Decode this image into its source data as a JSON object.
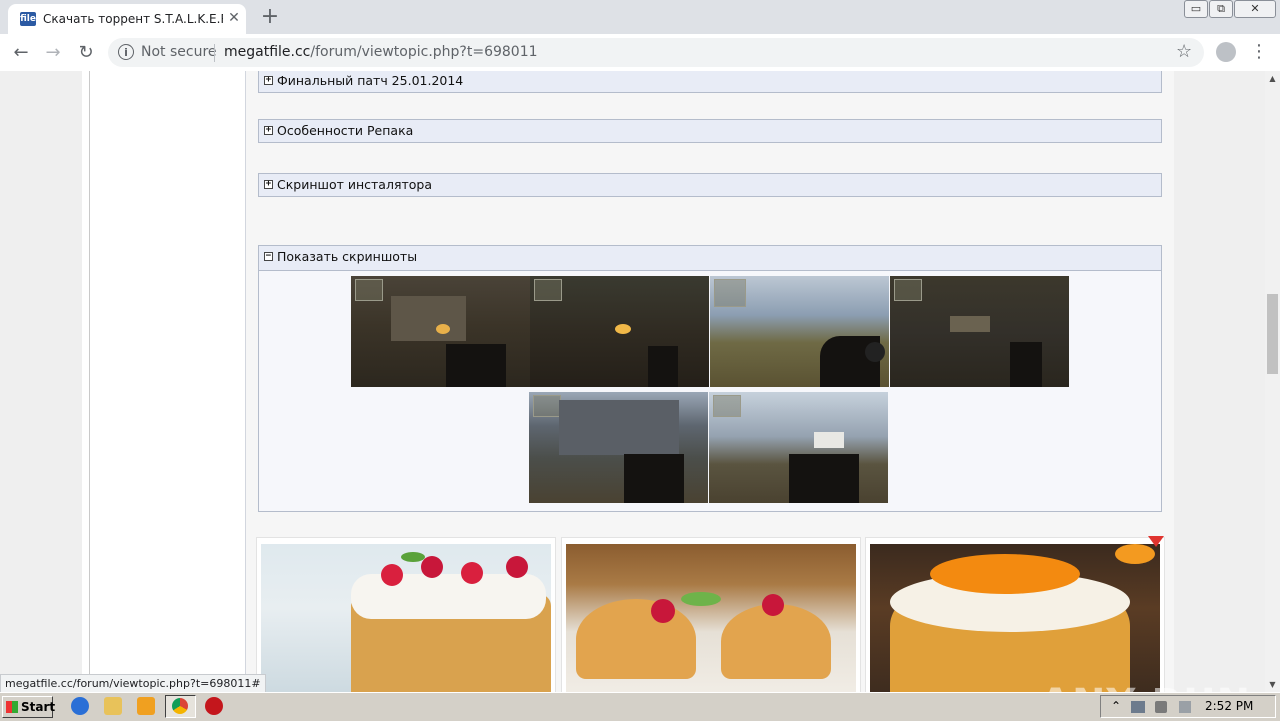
{
  "browser": {
    "tab": {
      "favicon_text": "file",
      "title": "Скачать торрент S.T.A.L.K.E.R.: S",
      "close_glyph": "✕"
    },
    "new_tab_glyph": "+",
    "window_controls": [
      "▭",
      "⧉",
      "✕"
    ],
    "nav": {
      "back": "←",
      "forward": "→",
      "reload": "↻"
    },
    "omnibox": {
      "security_label": "Not secure",
      "url_host": "megatfile.cc",
      "url_path": "/forum/viewtopic.php?t=698011"
    },
    "star_glyph": "☆",
    "menu_glyph": "⋮"
  },
  "post": {
    "spoilers": [
      {
        "label": "Финальный патч 25.01.2014",
        "icon": "+"
      },
      {
        "label": "Особенности Репака",
        "icon": "+"
      },
      {
        "label": "Скриншот инсталятора",
        "icon": "+"
      }
    ],
    "screenshots_spoiler": {
      "label": "Показать скриншоты",
      "icon": "−"
    }
  },
  "ads": {
    "images": [
      "raspberry-loaf-cake",
      "raspberry-cupcakes",
      "orange-glazed-cake"
    ],
    "watermark": "ANY RUN"
  },
  "status_bubble": "megatfile.cc/forum/viewtopic.php?t=698011#",
  "scrollbar": {
    "up": "▲",
    "down": "▼"
  },
  "taskbar": {
    "start_label": "Start",
    "clock": "2:52 PM"
  }
}
